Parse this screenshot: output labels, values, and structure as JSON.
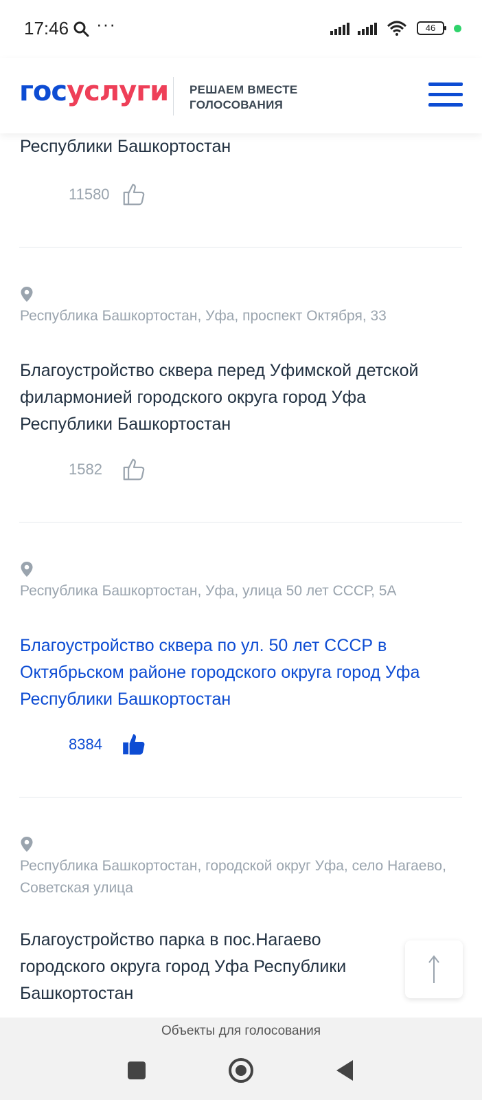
{
  "status_bar": {
    "time": "17:46",
    "more": "···",
    "battery": "46"
  },
  "header": {
    "logo_part1": "гос",
    "logo_part2": "услуги",
    "subtitle_line1": "РЕШАЕМ ВМЕСТЕ",
    "subtitle_line2": "ГОЛОСОВАНИЯ"
  },
  "items": [
    {
      "title": "Республики Башкортостан",
      "likes": "11580",
      "liked": false
    },
    {
      "address": "Республика Башкортостан, Уфа, проспект Октября, 33",
      "title": "Благоустройство сквера перед Уфимской детской филармонией городского округа город Уфа Республики Башкортостан",
      "likes": "1582",
      "liked": false
    },
    {
      "address": "Республика Башкортостан, Уфа, улица 50 лет СССР, 5А",
      "title": "Благоустройство сквера по ул. 50 лет СССР в Октябрьском районе городского округа город Уфа Республики Башкортостан",
      "likes": "8384",
      "liked": true
    },
    {
      "address": "Республика Башкортостан, городской округ Уфа, село Нагаево, Советская улица",
      "title": "Благоустройство парка в пос.Нагаево городского округа город Уфа Республики Башкортостан"
    }
  ],
  "bottom_caption": "Объекты для голосования",
  "colors": {
    "brand_blue": "#0d4cd3",
    "brand_red": "#ee3f58",
    "muted_text": "#9aa4ae",
    "body_text": "#233242"
  },
  "icons": {
    "search": "search-icon",
    "like": "thumbs-up-icon",
    "location": "location-pin-icon",
    "scroll_up": "arrow-up-icon"
  }
}
